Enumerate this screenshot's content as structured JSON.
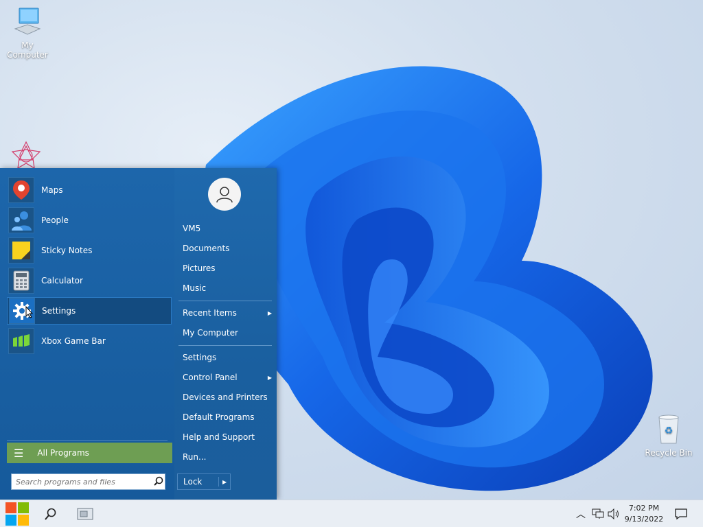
{
  "desktop": {
    "icons": [
      {
        "label": "My Computer"
      },
      {
        "label": "Recycle Bin"
      }
    ]
  },
  "start_menu": {
    "pinned": [
      {
        "label": "Maps",
        "icon": "maps-icon"
      },
      {
        "label": "People",
        "icon": "people-icon"
      },
      {
        "label": "Sticky Notes",
        "icon": "sticky-notes-icon"
      },
      {
        "label": "Calculator",
        "icon": "calculator-icon"
      },
      {
        "label": "Settings",
        "icon": "gear-icon",
        "highlighted": true
      },
      {
        "label": "Xbox Game Bar",
        "icon": "xbox-game-bar-icon"
      }
    ],
    "all_programs": "All Programs",
    "search_placeholder": "Search programs and files",
    "right": {
      "user": "VM5",
      "items": [
        {
          "label": "Documents"
        },
        {
          "label": "Pictures"
        },
        {
          "label": "Music"
        },
        {
          "label": "Recent Items",
          "submenu": true
        },
        {
          "label": "My Computer"
        },
        {
          "label": "Settings"
        },
        {
          "label": "Control Panel",
          "submenu": true
        },
        {
          "label": "Devices and Printers"
        },
        {
          "label": "Default Programs"
        },
        {
          "label": "Help and Support"
        },
        {
          "label": "Run..."
        }
      ],
      "lock": "Lock"
    }
  },
  "taskbar": {
    "time": "7:02 PM",
    "date": "9/13/2022"
  },
  "colors": {
    "menu_blue": "#1d66ab",
    "all_programs_green": "#6e9e53",
    "taskbar": "#e9eef4"
  }
}
